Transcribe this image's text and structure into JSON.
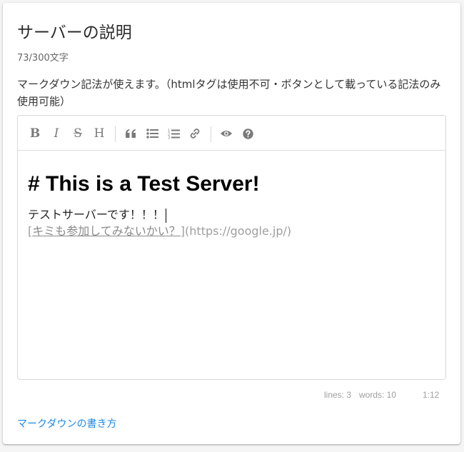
{
  "header": {
    "title": "サーバーの説明",
    "char_count": "73/300文字"
  },
  "description": "マークダウン記法が使えます。（htmlタグは使用不可・ボタンとして載っている記法のみ使用可能）",
  "toolbar": {
    "bold": "B",
    "italic": "I",
    "strikethrough": "S",
    "heading": "H",
    "icons": [
      "bold-icon",
      "italic-icon",
      "strikethrough-icon",
      "heading-icon",
      "quote-icon",
      "unordered-list-icon",
      "ordered-list-icon",
      "link-icon",
      "preview-icon",
      "help-icon"
    ]
  },
  "editor": {
    "heading_line": "# This is a Test Server!",
    "line2": "テストサーバーです！！！",
    "line3_open": "[",
    "line3_link_text": "キミも参加してみないかい？",
    "line3_close": "]",
    "line3_url": "(https://google.jp/)"
  },
  "statusbar": {
    "lines": "lines: 3",
    "words": "words: 10",
    "cursor": "1:12"
  },
  "footer": {
    "guide_link": "マークダウンの書き方"
  },
  "colors": {
    "link": "#1e88e5",
    "toolbar_icon": "#7a7a7a",
    "muted_text": "#9e9e9e"
  }
}
